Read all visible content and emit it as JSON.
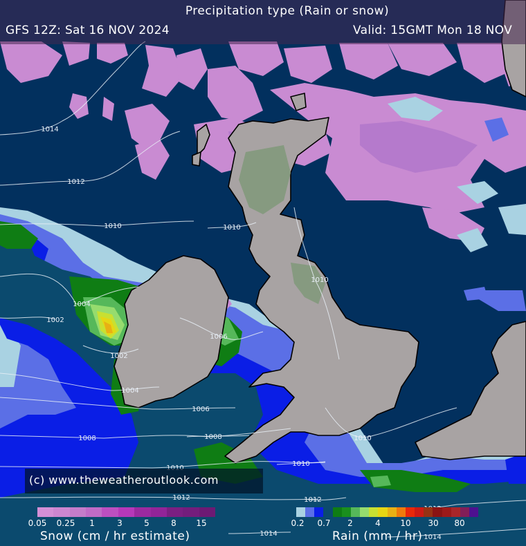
{
  "header": {
    "title": "Precipitation type (Rain or snow)",
    "model_run": "GFS 12Z: Sat 16 NOV 2024",
    "valid_time": "Valid: 15GMT Mon 18 NOV"
  },
  "credit": "(c) www.theweatheroutlook.com",
  "legend": {
    "snow": {
      "title": "Snow (cm / hr estimate)",
      "ticks": [
        "0.05",
        "0.25",
        "1",
        "3",
        "5",
        "8",
        "15"
      ],
      "colors": [
        "#d48fd6",
        "#cd86d0",
        "#c57cca",
        "#c06bc6",
        "#bc4fc0",
        "#b638b9",
        "#9c2aa0",
        "#922498",
        "#7b1f82",
        "#741d7c",
        "#6d1a74"
      ]
    },
    "rain": {
      "title": "Rain (mm / hr)",
      "ticks": [
        "0.2",
        "0.7",
        "2",
        "4",
        "10",
        "30",
        "80"
      ],
      "colors": [
        "#a9d2e2",
        "#5b6fe6",
        "#0a1ee6",
        "#0b4a6e",
        "#0f7d14",
        "#1a8f1e",
        "#56b85a",
        "#96dc6e",
        "#c8e032",
        "#e6d614",
        "#e8b014",
        "#ee7a0c",
        "#e8280a",
        "#cc1a14",
        "#963214",
        "#8a1414",
        "#9c1a1a",
        "#a8262a",
        "#821e58",
        "#4e1090"
      ]
    }
  },
  "colors": {
    "sea": "#02305e",
    "land": "#a8a3a3",
    "land_highland": "#869a80",
    "coast": "#000000",
    "isobar": "#e8eef6"
  },
  "isobars": [
    {
      "label": "1014"
    },
    {
      "label": "1012"
    },
    {
      "label": "1010"
    },
    {
      "label": "1010"
    },
    {
      "label": "1010"
    },
    {
      "label": "1004"
    },
    {
      "label": "1002"
    },
    {
      "label": "1002"
    },
    {
      "label": "1006"
    },
    {
      "label": "1004"
    },
    {
      "label": "1006"
    },
    {
      "label": "1008"
    },
    {
      "label": "1008"
    },
    {
      "label": "1010"
    },
    {
      "label": "1010"
    },
    {
      "label": "1010"
    },
    {
      "label": "1012"
    },
    {
      "label": "1012"
    },
    {
      "label": "1012"
    },
    {
      "label": "1014"
    },
    {
      "label": "1014"
    }
  ]
}
